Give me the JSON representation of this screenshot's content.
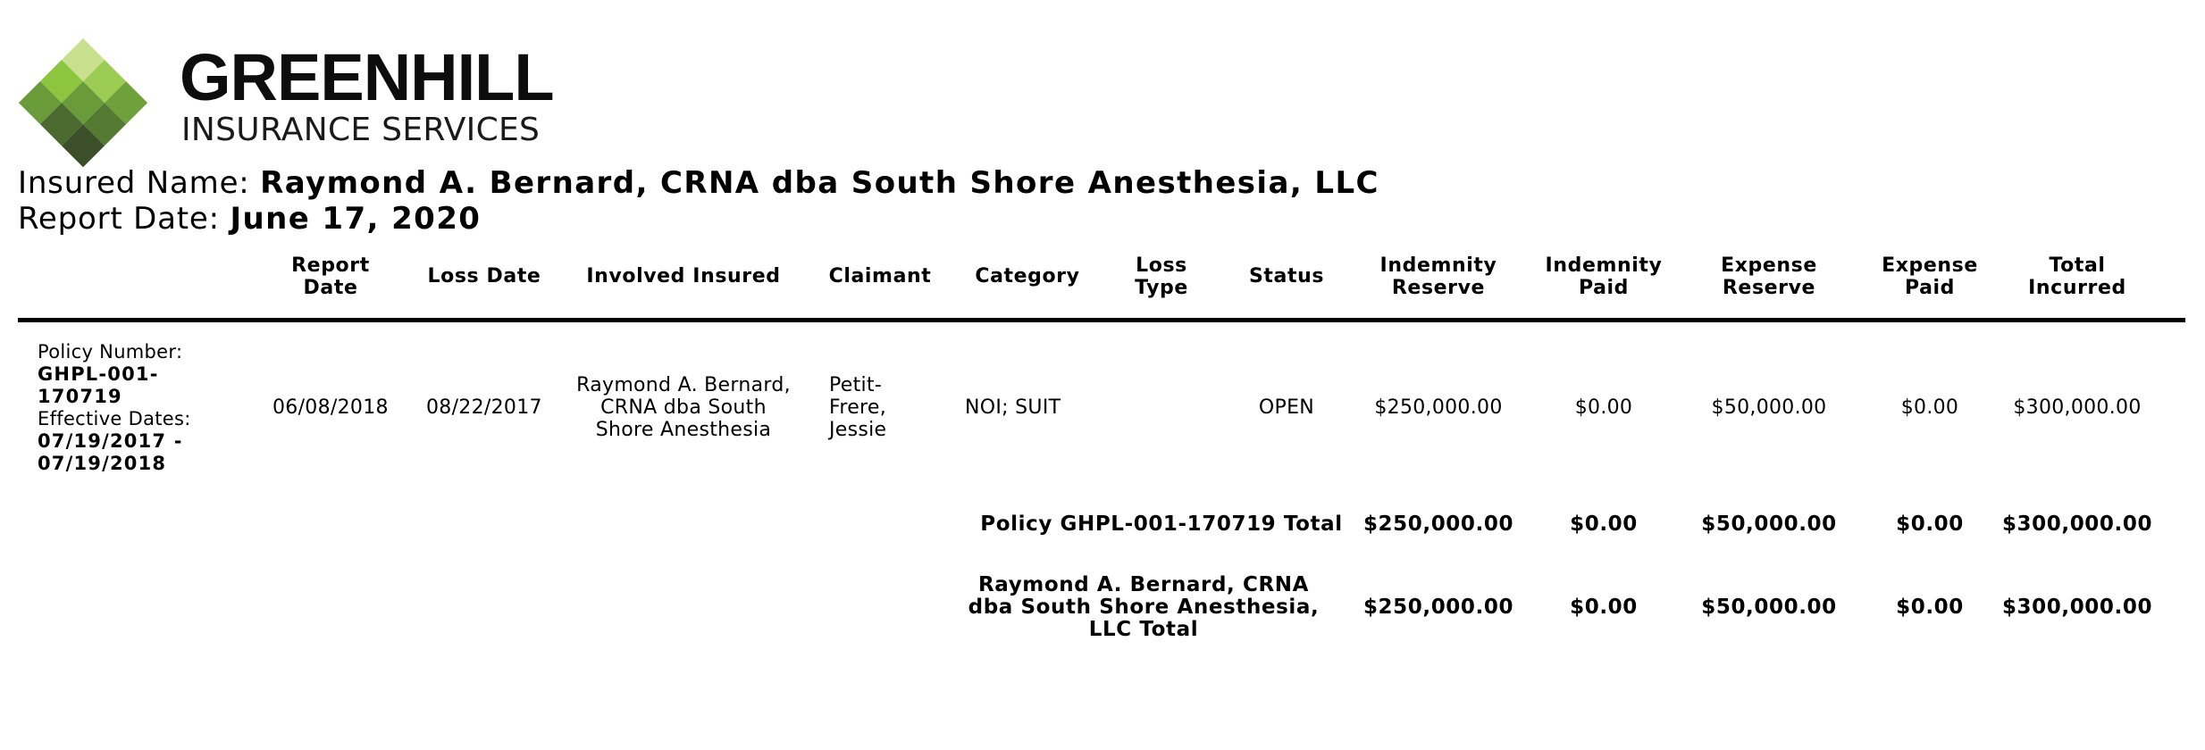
{
  "logo": {
    "name": "GREENHILL",
    "tagline": "INSURANCE SERVICES",
    "colors": [
      "#c7df8c",
      "#8cc63f",
      "#6fa33a",
      "#567c32",
      "#3b542b"
    ]
  },
  "header": {
    "insured_label": "Insured Name: ",
    "insured_value": "Raymond A. Bernard, CRNA dba South Shore Anesthesia, LLC",
    "report_label": "Report Date: ",
    "report_value": "June 17, 2020"
  },
  "columns": {
    "report_date": "Report Date",
    "loss_date": "Loss Date",
    "involved_insured": "Involved Insured",
    "claimant": "Claimant",
    "category": "Category",
    "loss_type": "Loss Type",
    "status": "Status",
    "indemnity_reserve": "Indemnity Reserve",
    "indemnity_paid": "Indemnity Paid",
    "expense_reserve": "Expense Reserve",
    "expense_paid": "Expense Paid",
    "total_incurred": "Total Incurred"
  },
  "policy": {
    "number_label": "Policy Number:",
    "number": "GHPL-001-170719",
    "dates_label": "Effective Dates:",
    "dates": "07/19/2017 - 07/19/2018"
  },
  "claim": {
    "report_date": "06/08/2018",
    "loss_date": "08/22/2017",
    "involved_insured": "Raymond A. Bernard, CRNA dba South Shore Anesthesia",
    "claimant": "Petit-Frere, Jessie",
    "category": "NOI; SUIT",
    "loss_type": "",
    "status": "OPEN",
    "indemnity_reserve": "$250,000.00",
    "indemnity_paid": "$0.00",
    "expense_reserve": "$50,000.00",
    "expense_paid": "$0.00",
    "total_incurred": "$300,000.00"
  },
  "policy_total": {
    "label": "Policy GHPL-001-170719 Total",
    "indemnity_reserve": "$250,000.00",
    "indemnity_paid": "$0.00",
    "expense_reserve": "$50,000.00",
    "expense_paid": "$0.00",
    "total_incurred": "$300,000.00"
  },
  "insured_total": {
    "label": "Raymond A. Bernard, CRNA dba South Shore Anesthesia, LLC Total",
    "indemnity_reserve": "$250,000.00",
    "indemnity_paid": "$0.00",
    "expense_reserve": "$50,000.00",
    "expense_paid": "$0.00",
    "total_incurred": "$300,000.00"
  }
}
